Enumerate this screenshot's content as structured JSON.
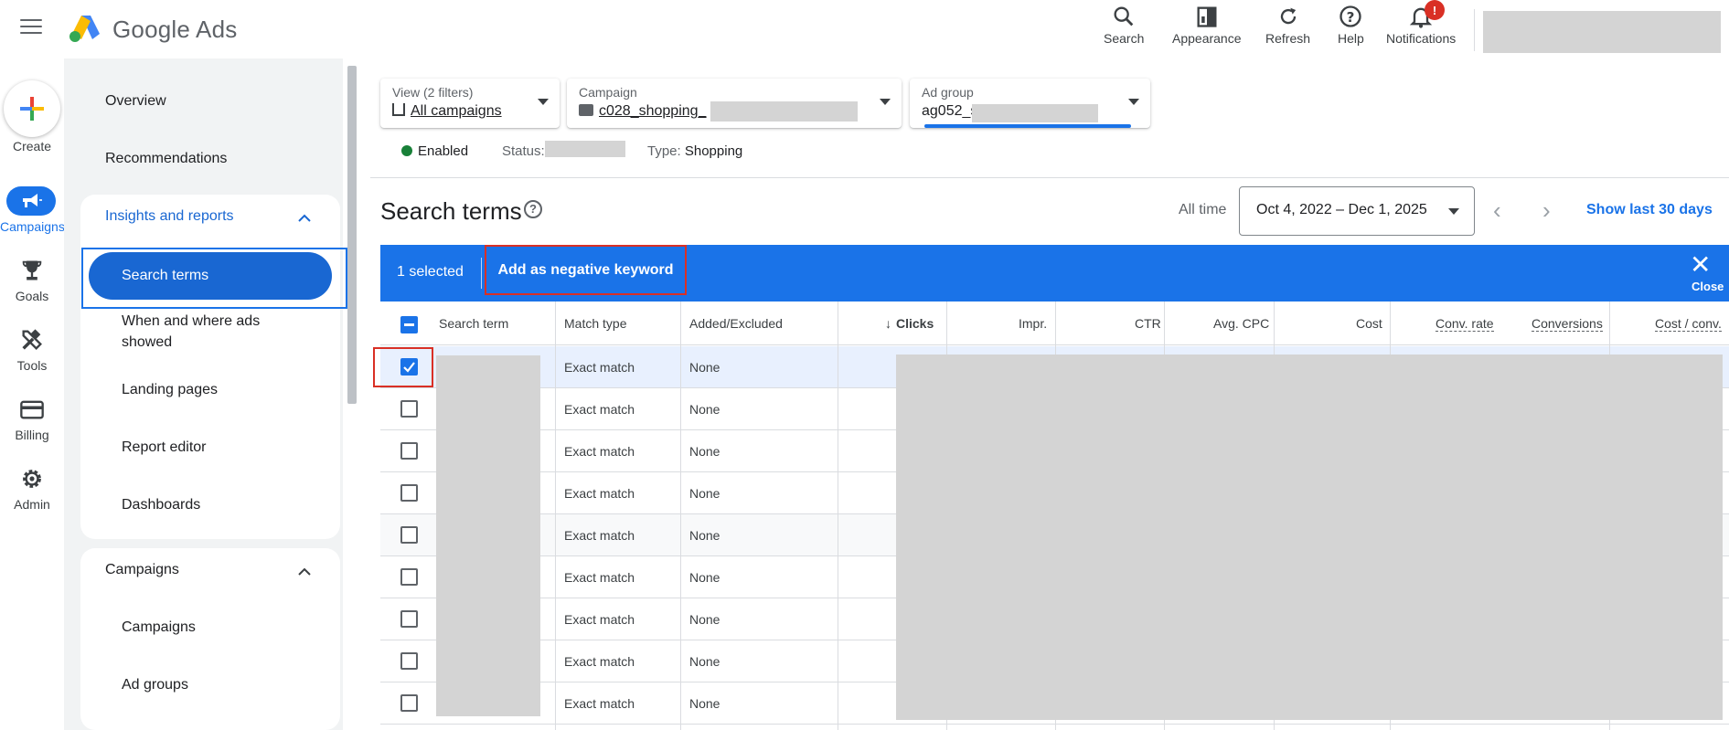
{
  "app": {
    "brand_google": "Google",
    "brand_ads": "Ads"
  },
  "top_actions": [
    {
      "label": "Search",
      "icon": "search-icon"
    },
    {
      "label": "Appearance",
      "icon": "appearance-icon"
    },
    {
      "label": "Refresh",
      "icon": "refresh-icon"
    },
    {
      "label": "Help",
      "icon": "help-icon"
    },
    {
      "label": "Notifications",
      "icon": "bell-icon",
      "badge": "!"
    }
  ],
  "rail": {
    "create": "Create",
    "campaigns": "Campaigns",
    "goals": "Goals",
    "tools": "Tools",
    "billing": "Billing",
    "admin": "Admin"
  },
  "nav": {
    "overview": "Overview",
    "recommendations": "Recommendations",
    "insights": "Insights and reports",
    "search_terms": "Search terms",
    "when_where_1": "When and where ads",
    "when_where_2": "showed",
    "landing_pages": "Landing pages",
    "report_editor": "Report editor",
    "dashboards": "Dashboards",
    "campaigns_section": "Campaigns",
    "campaigns": "Campaigns",
    "ad_groups": "Ad groups"
  },
  "filters": {
    "view_title": "View (2 filters)",
    "view_value": "All campaigns",
    "campaign_title": "Campaign",
    "campaign_value": "c028_shopping_",
    "adgroup_title": "Ad group",
    "adgroup_value": "ag052_s"
  },
  "status": {
    "enabled": "Enabled",
    "status_label": "Status:",
    "type_label": "Type:",
    "type_value": "Shopping"
  },
  "page": {
    "title": "Search terms",
    "help": "?",
    "all_time": "All time",
    "date_range": "Oct 4, 2022 – Dec 1, 2025",
    "show_last": "Show last 30 days"
  },
  "selection": {
    "count": "1 selected",
    "add_negative": "Add as negative keyword",
    "close": "Close"
  },
  "table": {
    "headers": {
      "search_term": "Search term",
      "match_type": "Match type",
      "added_excluded": "Added/Excluded",
      "clicks": "Clicks",
      "impr": "Impr.",
      "ctr": "CTR",
      "avg_cpc": "Avg. CPC",
      "cost": "Cost",
      "conv_rate": "Conv. rate",
      "conversions": "Conversions",
      "cost_conv": "Cost / conv."
    },
    "rows": [
      {
        "match": "Exact match",
        "added": "None",
        "checked": true
      },
      {
        "match": "Exact match",
        "added": "None",
        "checked": false
      },
      {
        "match": "Exact match",
        "added": "None",
        "checked": false
      },
      {
        "match": "Exact match",
        "added": "None",
        "checked": false
      },
      {
        "match": "Exact match",
        "added": "None",
        "checked": false
      },
      {
        "match": "Exact match",
        "added": "None",
        "checked": false
      },
      {
        "match": "Exact match",
        "added": "None",
        "checked": false
      },
      {
        "match": "Exact match",
        "added": "None",
        "checked": false
      },
      {
        "match": "Exact match",
        "added": "None",
        "checked": false
      }
    ]
  },
  "colors": {
    "primary": "#1a73e8",
    "active_nav": "#1967d2",
    "highlight_red": "#d93025",
    "enabled_green": "#188038",
    "redaction": "#d4d4d4"
  }
}
